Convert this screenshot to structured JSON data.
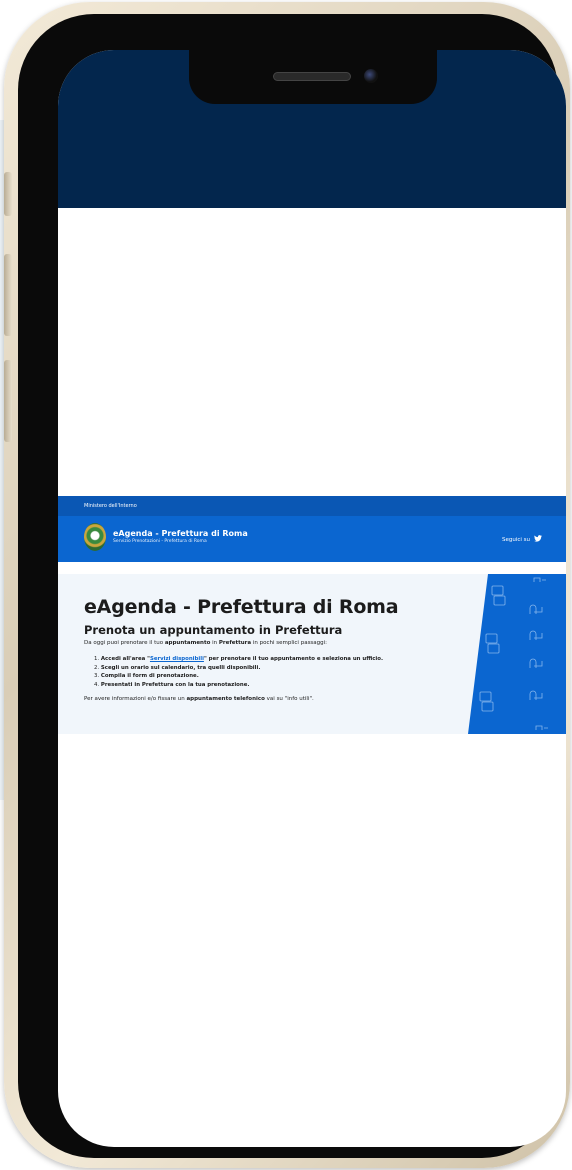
{
  "site": {
    "ministry": "Ministero dell'Interno",
    "brand_title": "eAgenda - Prefettura di Roma",
    "brand_subtitle": "Servizio Prenotazioni - Prefettura di Roma",
    "social_label": "Seguici su",
    "social_icon": "twitter-icon"
  },
  "hero": {
    "title": "eAgenda - Prefettura di Roma",
    "subtitle": "Prenota un appuntamento in Prefettura",
    "intro_pre": "Da oggi puoi prenotare il tuo ",
    "intro_bold1": "appuntamento",
    "intro_mid": " in ",
    "intro_bold2": "Prefettura",
    "intro_post": " in pochi semplici passaggi:",
    "steps": [
      {
        "num": "1.",
        "pre": "Accedi all'area \"",
        "link": "Servizi disponibili",
        "post": "\" per prenotare il tuo appuntamento e seleziona un ufficio."
      },
      {
        "num": "2.",
        "text": "Scegli un orario sul calendario, tra quelli disponibili."
      },
      {
        "num": "3.",
        "text": "Compila il form di prenotazione."
      },
      {
        "num": "4.",
        "text": "Presentati in Prefettura con la tua prenotazione."
      }
    ],
    "outro_pre": "Per avere informazioni e/o fissare un ",
    "outro_bold": "appuntamento telefonico",
    "outro_post": " vai su \"info utili\"."
  },
  "colors": {
    "top_band": "#03264d",
    "header_blue": "#0b66d0",
    "ministry_bar": "#0a57b4",
    "hero_bg": "#f1f6fb",
    "link": "#0b66d0"
  }
}
